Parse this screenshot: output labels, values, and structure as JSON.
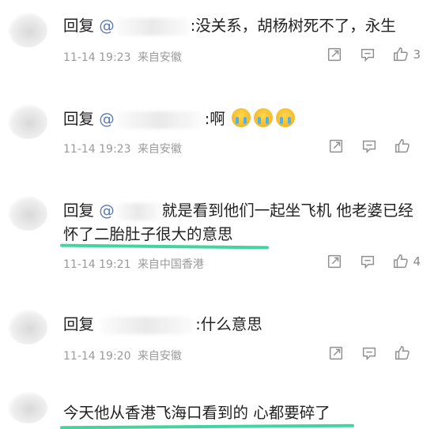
{
  "comments": [
    {
      "reply_label": "回复",
      "mention": "@",
      "text": ":没关系，胡杨树死不了，永生",
      "text_line2": "",
      "time": "11-14 19:23",
      "source": "来自安徽",
      "like_count": "3"
    },
    {
      "reply_label": "回复",
      "mention": "@",
      "text": ":啊",
      "text_line2": "",
      "time": "11-14 19:23",
      "source": "来自安徽",
      "like_count": ""
    },
    {
      "reply_label": "回复",
      "mention": "@",
      "text": "就是看到他们一起坐飞机 他老婆已经",
      "text_line2": "怀了二胎肚子很大的意思",
      "time": "11-14 19:21",
      "source": "来自中国香港",
      "like_count": "4"
    },
    {
      "reply_label": "回复",
      "mention": "",
      "text": ":什么意思",
      "text_line2": "",
      "time": "11-14 19:20",
      "source": "来自安徽",
      "like_count": ""
    },
    {
      "reply_label": "",
      "mention": "",
      "text": "今天他从香港飞海口看到的 心都要碎了",
      "text_line2": "",
      "time": "",
      "source": "",
      "like_count": ""
    }
  ],
  "icons": {
    "share": "share-icon",
    "comment": "comment-icon",
    "like": "thumbs-up-icon"
  },
  "colors": {
    "highlight_underline": "#3ad39a",
    "mention": "#5b7bb3",
    "meta": "#9a9a9a"
  }
}
